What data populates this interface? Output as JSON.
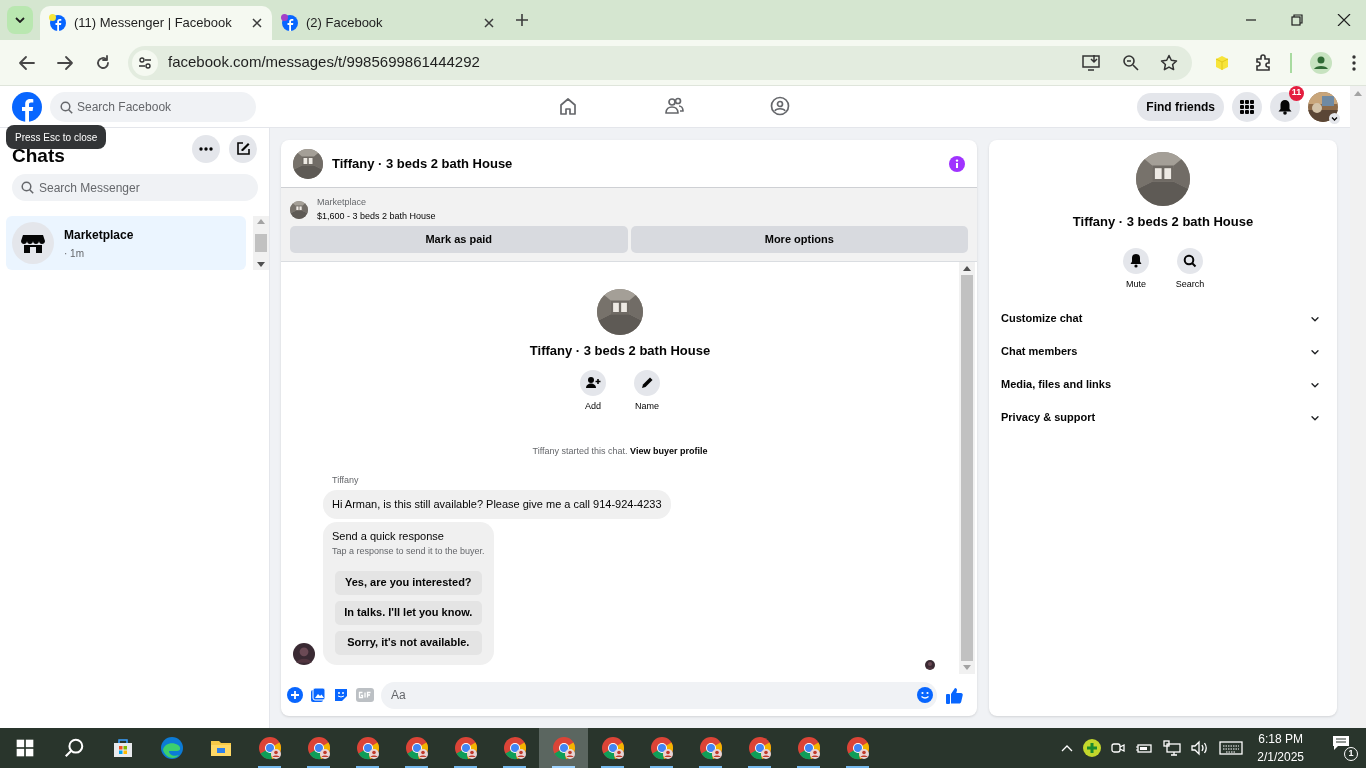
{
  "browser": {
    "tabs": [
      {
        "title": "(11) Messenger | Facebook",
        "selected": true,
        "color": "#f5e63a"
      },
      {
        "title": "(2) Facebook",
        "selected": false,
        "color": "#a33fc8"
      }
    ],
    "address": "facebook.com/messages/t/9985699861444292"
  },
  "nav": {
    "search_placeholder": "Search Facebook",
    "find_friends": "Find friends",
    "notification_count": "11",
    "tooltip": "Press Esc to close"
  },
  "chats": {
    "title": "Chats",
    "search_placeholder": "Search Messenger",
    "items": [
      {
        "name": "Marketplace",
        "time": "· 1m",
        "selected": true
      }
    ]
  },
  "conversation": {
    "title": "Tiffany · 3 beds 2 bath House",
    "listing_label": "Marketplace",
    "listing": "$1,600 - 3 beds 2 bath House",
    "buttons": [
      "Mark as paid",
      "More options"
    ],
    "intro_title": "Tiffany · 3 beds 2 bath House",
    "intro_actions": [
      {
        "kind": "add",
        "label": "Add"
      },
      {
        "kind": "name",
        "label": "Name"
      }
    ],
    "started": "Tiffany started this chat.",
    "profile_link": "View buyer profile",
    "sender": "Tiffany",
    "message": "Hi Arman, is this still available? Please give me a call 914-924-4233",
    "quick_title": "Send a quick response",
    "quick_hint": "Tap a response to send it to the buyer.",
    "quick_options": [
      "Yes, are you interested?",
      "In talks. I'll let you know.",
      "Sorry, it's not available."
    ],
    "composer_placeholder": "Aa"
  },
  "details": {
    "title": "Tiffany · 3 beds 2 bath House",
    "actions": [
      {
        "kind": "mute",
        "label": "Mute"
      },
      {
        "kind": "search",
        "label": "Search"
      }
    ],
    "sections": [
      {
        "label": "Customize chat",
        "expanded": false
      },
      {
        "label": "Chat members",
        "expanded": false
      },
      {
        "label": "Media, files and links",
        "expanded": false
      },
      {
        "label": "Privacy & support",
        "expanded": false
      }
    ]
  },
  "taskbar": {
    "apps": [
      {
        "kind": "start",
        "selected": false
      },
      {
        "kind": "search",
        "selected": false
      },
      {
        "kind": "store",
        "selected": false
      },
      {
        "kind": "edge",
        "selected": false
      },
      {
        "kind": "explorer",
        "selected": false
      },
      {
        "kind": "chrome",
        "selected": false
      },
      {
        "kind": "chrome",
        "selected": false
      },
      {
        "kind": "chrome",
        "selected": false
      },
      {
        "kind": "chrome",
        "selected": false
      },
      {
        "kind": "chrome",
        "selected": false
      },
      {
        "kind": "chrome",
        "selected": false
      },
      {
        "kind": "chrome",
        "selected": true
      },
      {
        "kind": "chrome",
        "selected": false
      },
      {
        "kind": "chrome",
        "selected": false
      },
      {
        "kind": "chrome",
        "selected": false
      },
      {
        "kind": "chrome",
        "selected": false
      },
      {
        "kind": "chrome",
        "selected": false
      },
      {
        "kind": "chrome",
        "selected": false
      }
    ],
    "time": "6:18 PM",
    "date": "2/1/2025",
    "notification_count": "1"
  }
}
